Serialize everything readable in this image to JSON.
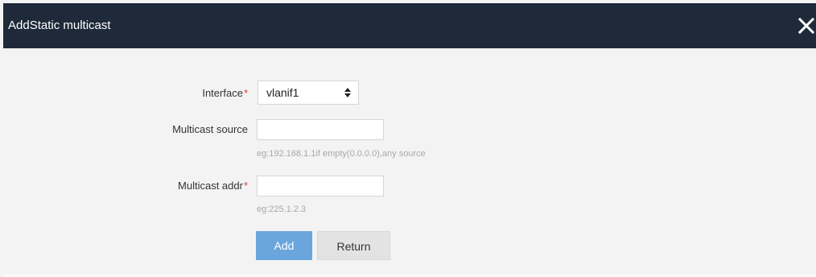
{
  "dialog": {
    "title": "AddStatic multicast",
    "close_icon": "close-icon"
  },
  "form": {
    "interface": {
      "label": "Interface",
      "required_mark": "*",
      "selected_value": "vlanif1",
      "arrow_icon": "updown-arrows-icon"
    },
    "multicast_source": {
      "label": "Multicast source",
      "value": "",
      "hint": "eg:192.168.1.1if empty(0.0.0.0),any source"
    },
    "multicast_addr": {
      "label": "Multicast addr",
      "required_mark": "*",
      "value": "",
      "hint": "eg:225.1.2.3"
    },
    "buttons": {
      "add_label": "Add",
      "return_label": "Return"
    }
  },
  "colors": {
    "titlebar_bg": "#1e2a3a",
    "body_bg": "#f3f3f3",
    "required": "#e53935",
    "add_button_bg": "#6aa6dd",
    "return_button_bg": "#e3e3e3",
    "hint_text": "#a8a8a8"
  }
}
